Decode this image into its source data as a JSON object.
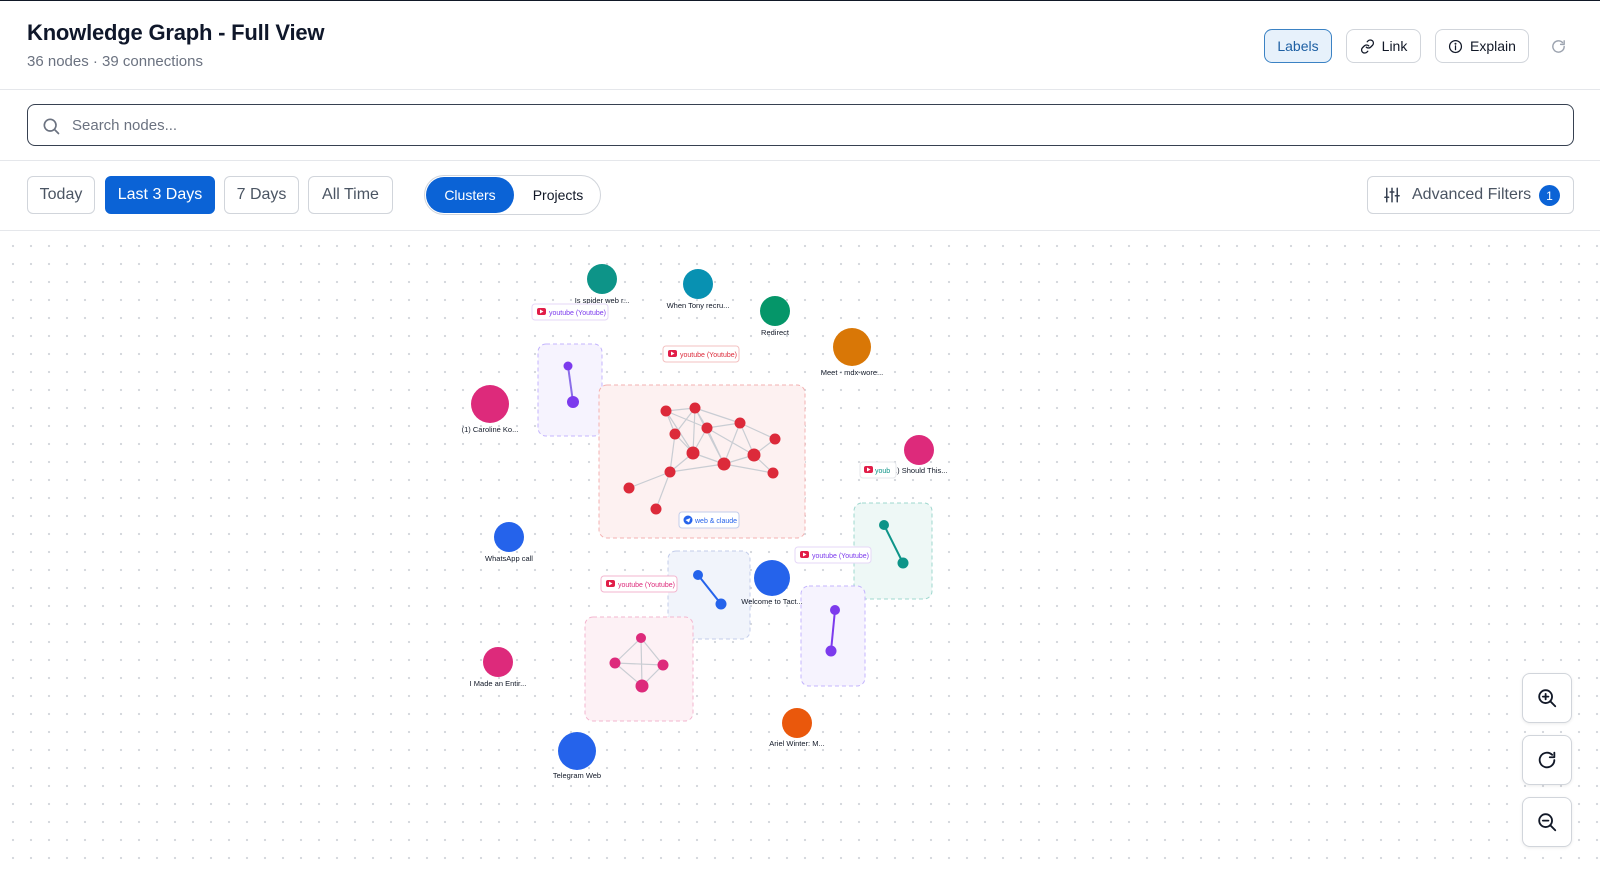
{
  "header": {
    "title": "Knowledge Graph - Full View",
    "subtitle": "36 nodes · 39 connections",
    "buttons": {
      "labels": "Labels",
      "link": "Link",
      "explain": "Explain"
    }
  },
  "search": {
    "placeholder": "Search nodes...",
    "value": ""
  },
  "filters": {
    "time": [
      "Today",
      "Last 3 Days",
      "7 Days",
      "All Time"
    ],
    "time_active": "Last 3 Days",
    "view": [
      "Clusters",
      "Projects"
    ],
    "view_active": "Clusters",
    "advanced_label": "Advanced Filters",
    "advanced_count": "1"
  },
  "graph": {
    "node_labels": [
      "Is spider web r...",
      "When Tony recru...",
      "Redirect",
      "Meet - mdx-wore...",
      "(1) Caroline Ko...",
      "(1) Should This...",
      "WhatsApp call",
      "Welcome to Tact...",
      "I Made an Entir...",
      "Ariel Winter: M...",
      "Telegram Web"
    ],
    "cluster_tags": [
      "youtube (Youtube)",
      "youtube (Youtube)",
      "youb",
      "web & claude",
      "youtube (Youtube)",
      "youtube (Youtube)"
    ]
  },
  "colors": {
    "primary": "#0b63d6",
    "red": "#dc2a3a",
    "pink": "#dd2a7b",
    "purple": "#7c3aed",
    "blue": "#2563eb",
    "teal": "#0d9488",
    "green": "#059669",
    "cyan": "#0891b2",
    "orange": "#d97706",
    "deep_orange": "#ea580c"
  },
  "icons": {
    "link": "link-icon",
    "explain": "info-icon",
    "refresh": "refresh-icon",
    "search": "search-icon",
    "filters": "sliders-icon",
    "zoom_in": "zoom-in-icon",
    "zoom_reset": "reset-icon",
    "zoom_out": "zoom-out-icon",
    "youtube": "youtube-icon",
    "telegram": "telegram-icon"
  }
}
